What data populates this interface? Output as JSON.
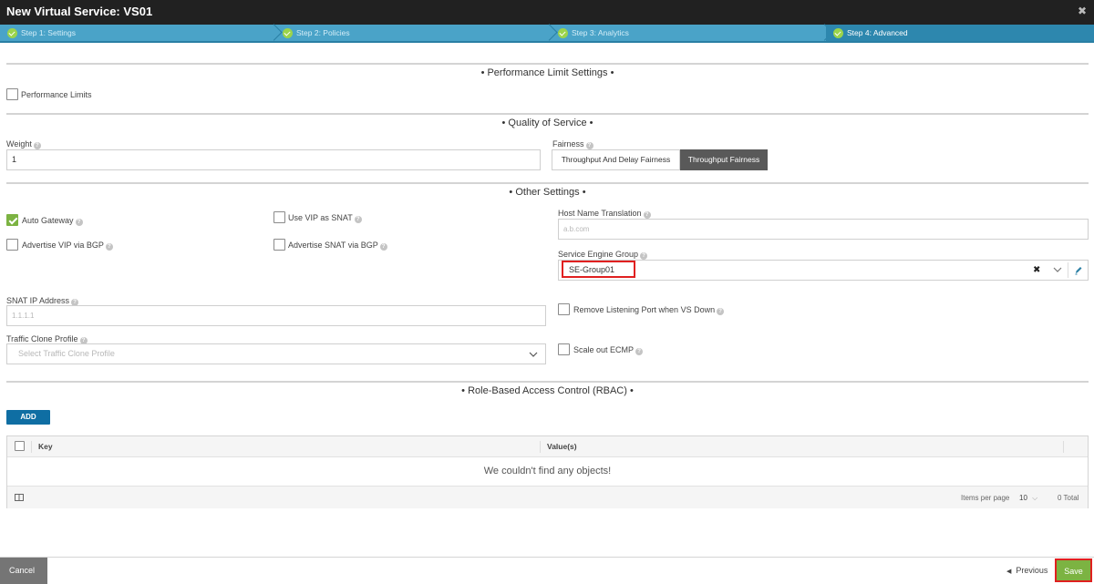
{
  "window": {
    "title": "New Virtual Service: VS01",
    "close_glyph": "✖"
  },
  "steps": [
    {
      "label": "Step 1: Settings",
      "active": false
    },
    {
      "label": "Step 2: Policies",
      "active": false
    },
    {
      "label": "Step 3: Analytics",
      "active": false
    },
    {
      "label": "Step 4: Advanced",
      "active": true
    }
  ],
  "sections": {
    "performance": "• Performance Limit Settings •",
    "qos": "• Quality of Service •",
    "other": "• Other Settings •",
    "rbac": "• Role-Based Access Control (RBAC) •"
  },
  "performance": {
    "label": "Performance Limits",
    "checked": false
  },
  "qos": {
    "weight_label": "Weight",
    "weight_value": "1",
    "fairness_label": "Fairness",
    "fairness_options": [
      "Throughput And Delay Fairness",
      "Throughput Fairness"
    ],
    "fairness_selected": "Throughput Fairness"
  },
  "other": {
    "auto_gateway": {
      "label": "Auto Gateway",
      "checked": true
    },
    "use_vip_snat": {
      "label": "Use VIP as SNAT",
      "checked": false
    },
    "advertise_vip_bgp": {
      "label": "Advertise VIP via BGP",
      "checked": false
    },
    "advertise_snat_bgp": {
      "label": "Advertise SNAT via BGP",
      "checked": false
    },
    "host_name_translation_label": "Host Name Translation",
    "host_name_translation_placeholder": "a.b.com",
    "se_group_label": "Service Engine Group",
    "se_group_value": "SE-Group01",
    "snat_ip_label": "SNAT IP Address",
    "snat_ip_placeholder": "1.1.1.1",
    "traffic_clone_label": "Traffic Clone Profile",
    "traffic_clone_placeholder": "Select Traffic Clone Profile",
    "remove_listening": {
      "label": "Remove Listening Port when VS Down",
      "checked": false
    },
    "scale_out_ecmp": {
      "label": "Scale out ECMP",
      "checked": false
    }
  },
  "rbac": {
    "add_label": "ADD",
    "columns": [
      "Key",
      "Value(s)"
    ],
    "empty_message": "We couldn't find any objects!",
    "items_per_page_label": "Items per page",
    "items_per_page_value": "10",
    "total_label": "0 Total"
  },
  "footer": {
    "cancel_label": "Cancel",
    "previous_label": "Previous",
    "save_label": "Save"
  },
  "colors": {
    "accent": "#4aa3c8",
    "save": "#7cb342",
    "highlight": "#e02020"
  }
}
